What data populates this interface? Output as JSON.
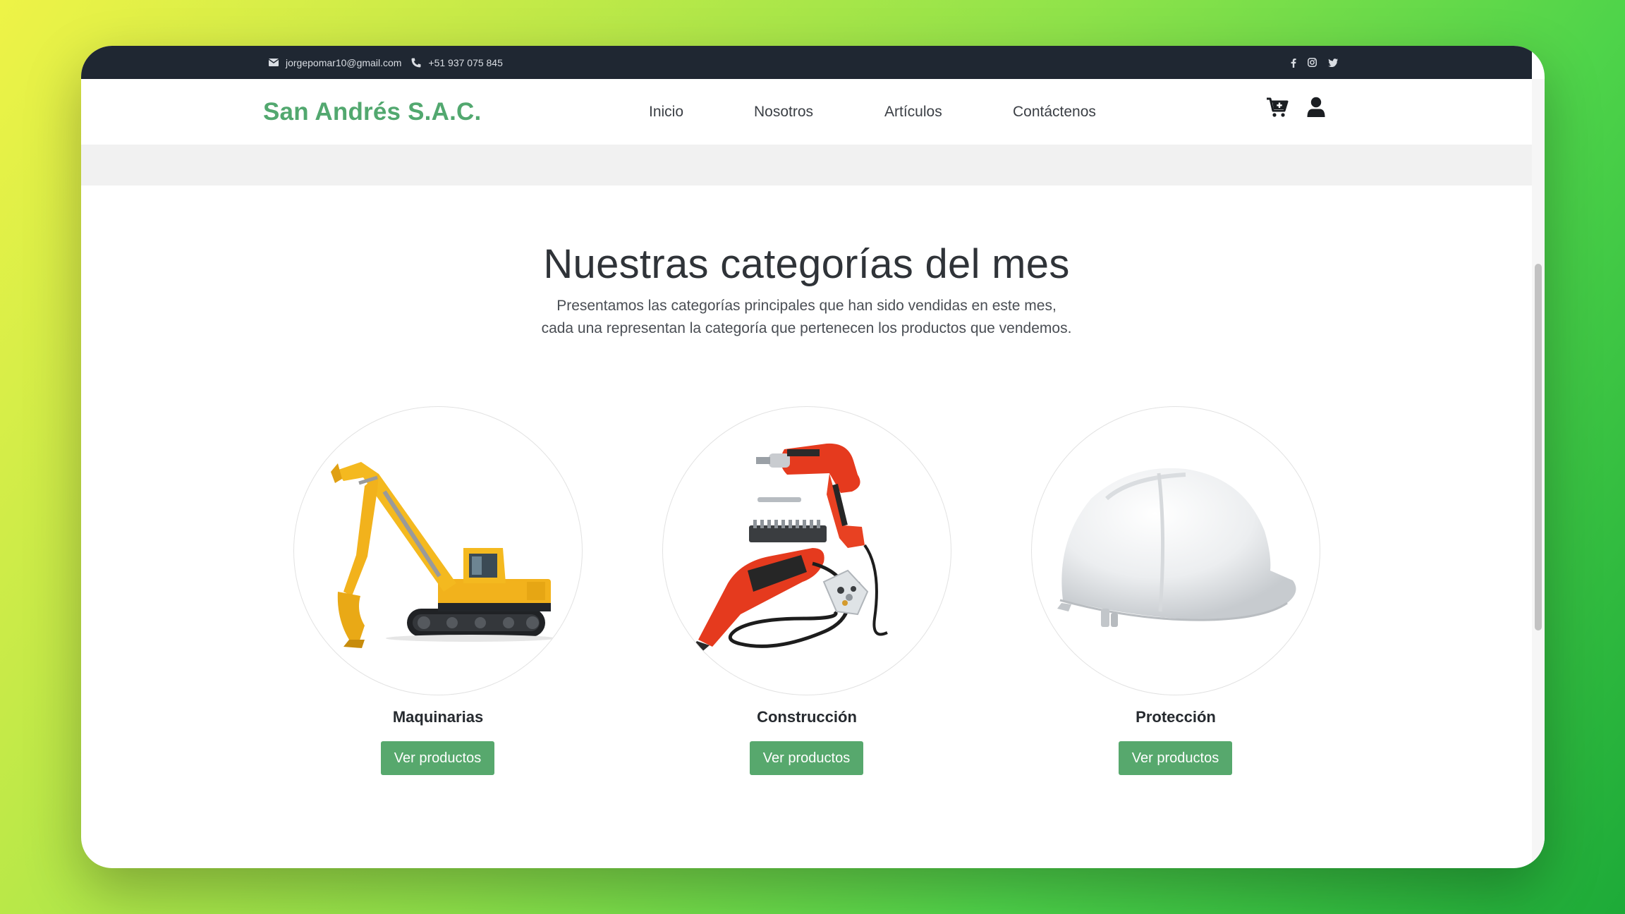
{
  "topbar": {
    "email": "jorgepomar10@gmail.com",
    "phone": "+51 937 075 845",
    "icons": [
      "envelope-icon",
      "phone-icon",
      "facebook-icon",
      "instagram-icon",
      "twitter-icon"
    ]
  },
  "navbar": {
    "brand": "San Andrés S.A.C.",
    "menu": [
      "Inicio",
      "Nosotros",
      "Artículos",
      "Contáctenos"
    ],
    "icons": [
      "cart-icon",
      "user-icon"
    ]
  },
  "section": {
    "title": "Nuestras categorías del mes",
    "subtitle_line1": "Presentamos las categorías principales que han sido vendidas en este mes,",
    "subtitle_line2": "cada una representan la categoría que pertenecen los productos que vendemos."
  },
  "categories": [
    {
      "name": "Maquinarias",
      "button": "Ver productos",
      "image": "excavator-image"
    },
    {
      "name": "Construcción",
      "button": "Ver productos",
      "image": "power-tools-image"
    },
    {
      "name": "Protección",
      "button": "Ver productos",
      "image": "hard-hat-image"
    }
  ],
  "colors": {
    "brand": "#52a86f",
    "button": "#57a86d",
    "topbar": "#1f2732"
  }
}
